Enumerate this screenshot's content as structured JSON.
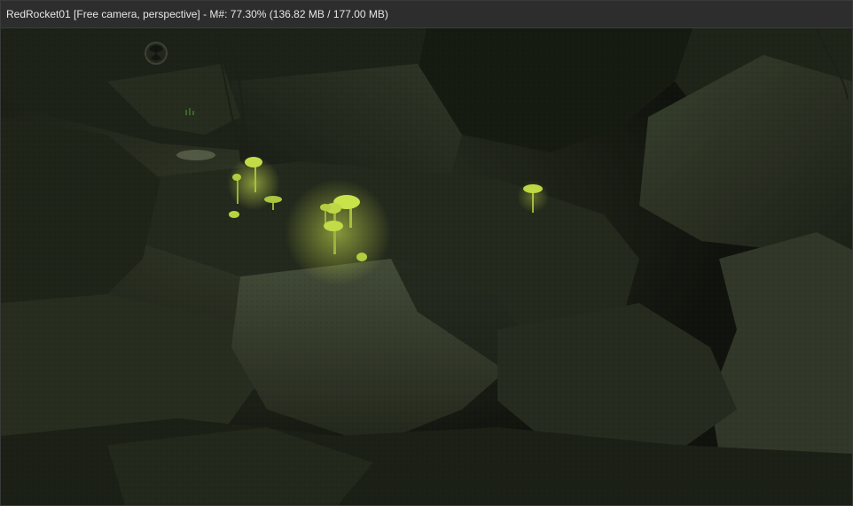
{
  "window": {
    "title": "RedRocket01 [Free camera, perspective] - M#: 77.30% (136.82 MB / 177.00 MB)"
  },
  "viewport": {
    "scene_name": "RedRocket01",
    "camera_mode": "Free camera, perspective",
    "memory_percent": 77.3,
    "memory_used_mb": 136.82,
    "memory_total_mb": 177.0,
    "colors": {
      "mushroom_glow": "#b8d838",
      "rock_dark": "#1c2118",
      "rock_mid": "#3a4230",
      "rock_light": "#56604a"
    }
  }
}
